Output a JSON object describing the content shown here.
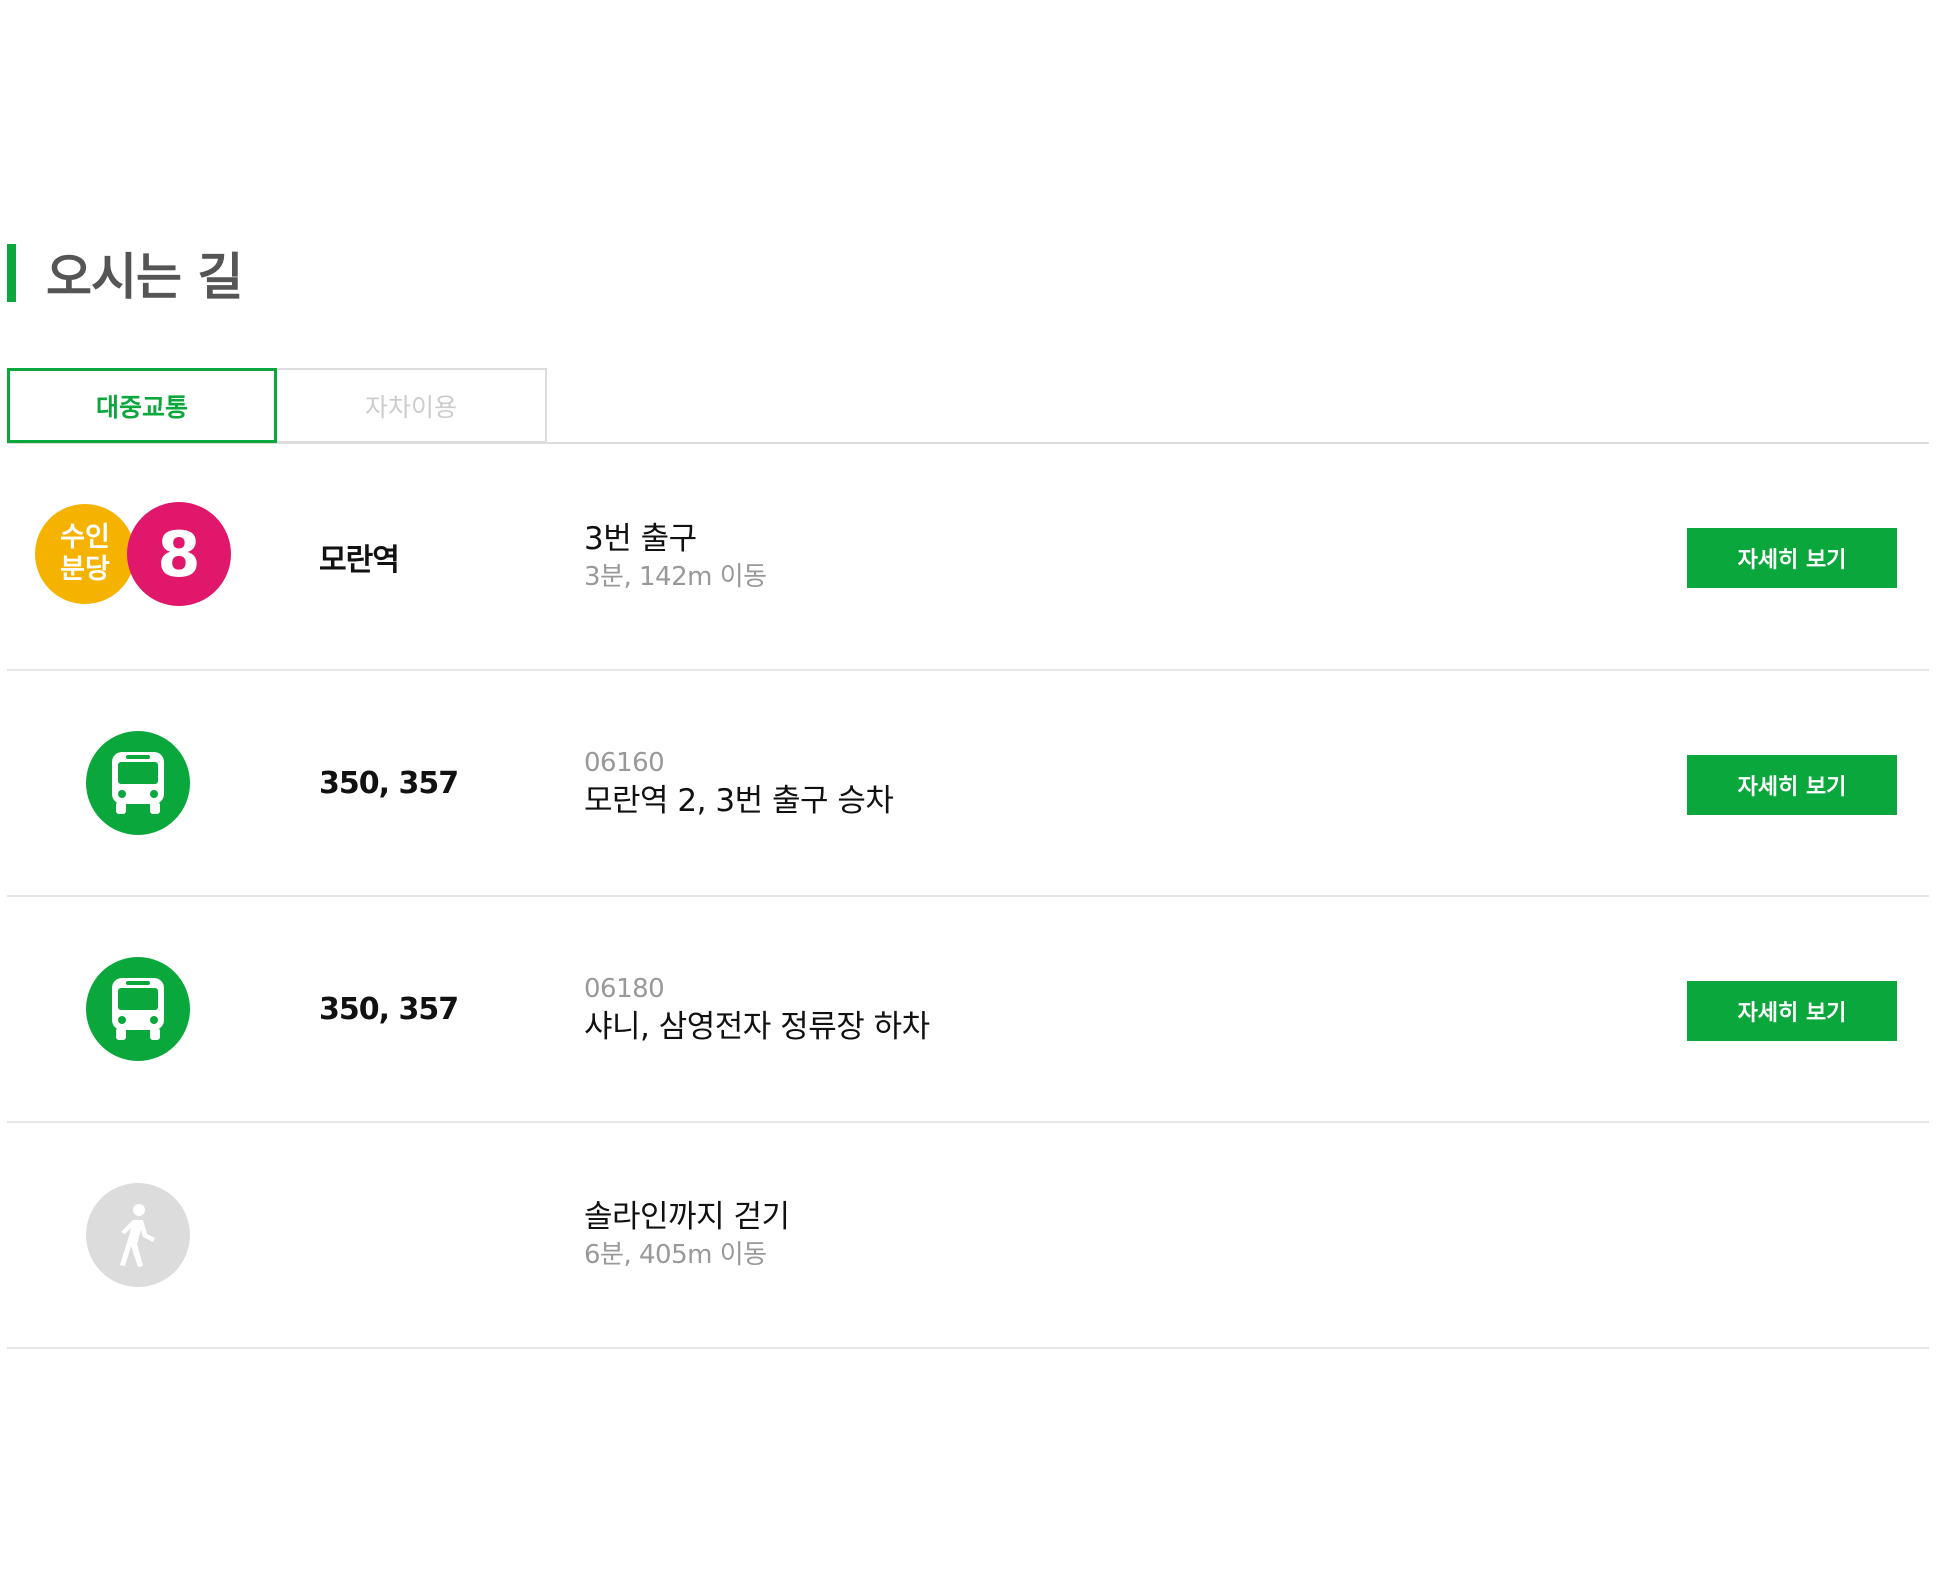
{
  "section": {
    "title": "오시는 길"
  },
  "tabs": [
    {
      "label": "대중교통",
      "active": true
    },
    {
      "label": "자차이용",
      "active": false
    }
  ],
  "colors": {
    "accent": "#0aa83c",
    "bundang_line": "#f5b300",
    "line8": "#e0176a",
    "walk_icon_bg": "#dcdcdc",
    "divider": "#e5e5e5"
  },
  "routes": [
    {
      "type": "subway",
      "badges": {
        "line_a_top": "수인",
        "line_a_bottom": "분당",
        "line_b": "8"
      },
      "name": "모란역",
      "main": "3번 출구",
      "sub": "3분, 142m 이동",
      "button": "자세히 보기"
    },
    {
      "type": "bus",
      "icon": "bus-icon",
      "name": "350, 357",
      "stop_code": "06160",
      "main": "모란역 2, 3번 출구 승차",
      "button": "자세히 보기"
    },
    {
      "type": "bus",
      "icon": "bus-icon",
      "name": "350, 357",
      "stop_code": "06180",
      "main": "샤니, 삼영전자 정류장 하차",
      "button": "자세히 보기"
    },
    {
      "type": "walk",
      "icon": "walk-icon",
      "main": "솔라인까지 걷기",
      "sub": "6분, 405m 이동"
    }
  ]
}
